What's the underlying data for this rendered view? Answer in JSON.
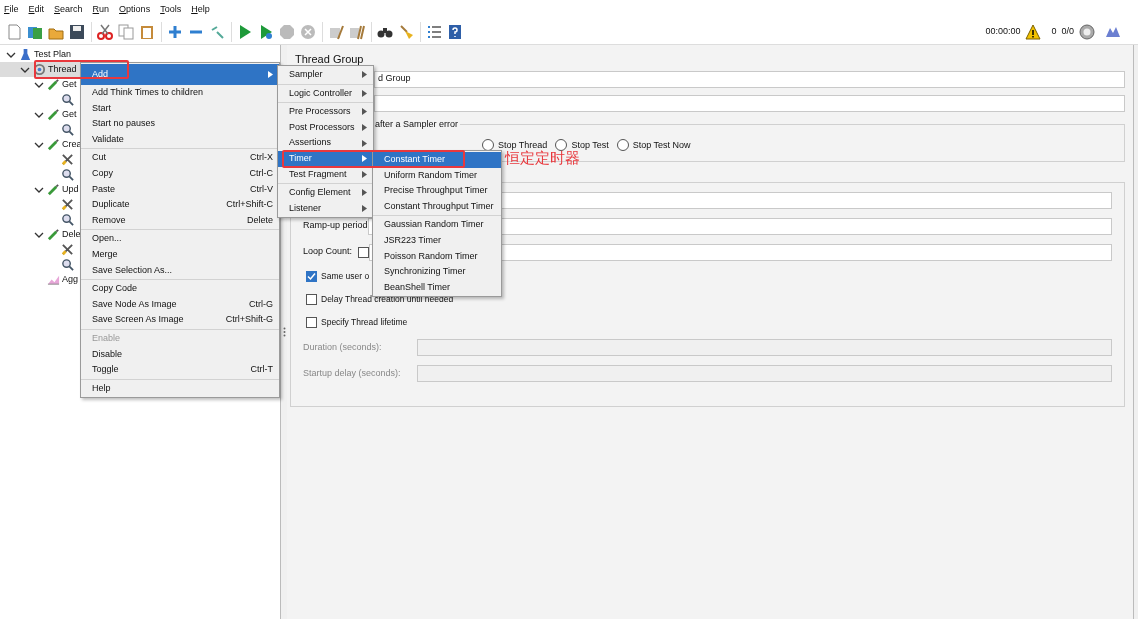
{
  "menubar": [
    {
      "label": "File"
    },
    {
      "label": "Edit"
    },
    {
      "label": "Search"
    },
    {
      "label": "Run"
    },
    {
      "label": "Options"
    },
    {
      "label": "Tools"
    },
    {
      "label": "Help"
    }
  ],
  "status": {
    "elapsed": "00:00:00",
    "warnings": "0",
    "threads": "0/0"
  },
  "tree": [
    {
      "kind": "plan",
      "label": "Test Plan",
      "expanded": true,
      "selected": false,
      "children": [
        {
          "kind": "threadgroup",
          "label": "Thread",
          "expanded": true,
          "selected": true,
          "children": [
            {
              "kind": "sampler",
              "label": "Get",
              "expanded": true,
              "selected": false,
              "children": [
                {
                  "kind": "inspector",
                  "selected": false
                }
              ]
            },
            {
              "kind": "sampler",
              "label": "Get",
              "expanded": true,
              "selected": false,
              "children": [
                {
                  "kind": "inspector",
                  "selected": false
                }
              ]
            },
            {
              "kind": "sampler",
              "label": "Crea",
              "expanded": true,
              "selected": false,
              "children": [
                {
                  "kind": "tool",
                  "selected": false
                },
                {
                  "kind": "inspector",
                  "selected": false
                }
              ]
            },
            {
              "kind": "sampler",
              "label": "Upd",
              "expanded": true,
              "selected": false,
              "children": [
                {
                  "kind": "tool",
                  "selected": false
                },
                {
                  "kind": "inspector",
                  "selected": false
                }
              ]
            },
            {
              "kind": "sampler",
              "label": "Dele",
              "expanded": true,
              "selected": false,
              "children": [
                {
                  "kind": "tool",
                  "selected": false
                },
                {
                  "kind": "inspector",
                  "selected": false
                }
              ]
            },
            {
              "kind": "listener",
              "label": "Agg",
              "selected": false
            }
          ]
        }
      ]
    }
  ],
  "context_menu": {
    "groups": [
      [
        {
          "label": "Add",
          "submenu": true,
          "selected": true,
          "disabled": false,
          "outlined": true
        },
        {
          "label": "Add Think Times to children",
          "selected": false,
          "disabled": false
        },
        {
          "label": "Start",
          "selected": false,
          "disabled": false
        },
        {
          "label": "Start no pauses",
          "selected": false,
          "disabled": false
        },
        {
          "label": "Validate",
          "selected": false,
          "disabled": false
        }
      ],
      [
        {
          "label": "Cut",
          "shortcut": "Ctrl-X",
          "selected": false,
          "disabled": false
        },
        {
          "label": "Copy",
          "shortcut": "Ctrl-C",
          "selected": false,
          "disabled": false
        },
        {
          "label": "Paste",
          "shortcut": "Ctrl-V",
          "selected": false,
          "disabled": false
        },
        {
          "label": "Duplicate",
          "shortcut": "Ctrl+Shift-C",
          "selected": false,
          "disabled": false
        },
        {
          "label": "Remove",
          "shortcut": "Delete",
          "selected": false,
          "disabled": false
        }
      ],
      [
        {
          "label": "Open...",
          "selected": false,
          "disabled": false
        },
        {
          "label": "Merge",
          "selected": false,
          "disabled": false
        },
        {
          "label": "Save Selection As...",
          "selected": false,
          "disabled": false
        }
      ],
      [
        {
          "label": "Copy Code",
          "selected": false,
          "disabled": false
        },
        {
          "label": "Save Node As Image",
          "shortcut": "Ctrl-G",
          "selected": false,
          "disabled": false
        },
        {
          "label": "Save Screen As Image",
          "shortcut": "Ctrl+Shift-G",
          "selected": false,
          "disabled": false
        }
      ],
      [
        {
          "label": "Enable",
          "selected": false,
          "disabled": true
        },
        {
          "label": "Disable",
          "selected": false,
          "disabled": false
        },
        {
          "label": "Toggle",
          "shortcut": "Ctrl-T",
          "selected": false,
          "disabled": false
        }
      ],
      [
        {
          "label": "Help",
          "selected": false,
          "disabled": false
        }
      ]
    ]
  },
  "add_menu": {
    "groups": [
      [
        {
          "label": "Sampler",
          "submenu": true,
          "selected": false
        }
      ],
      [
        {
          "label": "Logic Controller",
          "submenu": true,
          "selected": false
        }
      ],
      [
        {
          "label": "Pre Processors",
          "submenu": true,
          "selected": false
        },
        {
          "label": "Post Processors",
          "submenu": true,
          "selected": false
        },
        {
          "label": "Assertions",
          "submenu": true,
          "selected": false
        },
        {
          "label": "Timer",
          "submenu": true,
          "selected": true,
          "outlined": true
        },
        {
          "label": "Test Fragment",
          "submenu": true,
          "selected": false
        }
      ],
      [
        {
          "label": "Config Element",
          "submenu": true,
          "selected": false
        },
        {
          "label": "Listener",
          "submenu": true,
          "selected": false
        }
      ]
    ]
  },
  "timer_menu": {
    "groups": [
      [
        {
          "label": "Constant Timer",
          "selected": true
        },
        {
          "label": "Uniform Random Timer",
          "selected": false
        },
        {
          "label": "Precise Throughput Timer",
          "selected": false
        },
        {
          "label": "Constant Throughput Timer",
          "selected": false
        }
      ],
      [
        {
          "label": "Gaussian Random Timer",
          "selected": false
        },
        {
          "label": "JSR223 Timer",
          "selected": false
        },
        {
          "label": "Poisson Random Timer",
          "selected": false
        },
        {
          "label": "Synchronizing Timer",
          "selected": false
        },
        {
          "label": "BeanShell Timer",
          "selected": false
        }
      ]
    ]
  },
  "annotation": {
    "text": "恒定定时器"
  },
  "panel": {
    "title": "Thread Group",
    "name_value": "d Group",
    "error_action": {
      "legend": "after a Sampler error",
      "options": [
        {
          "label": "Stop Thread",
          "selected": false
        },
        {
          "label": "Stop Test",
          "selected": false
        },
        {
          "label": "Stop Test Now",
          "selected": false
        }
      ]
    },
    "rampup_label": "Ramp-up period",
    "loop_label": "Loop Count:",
    "infinite": {
      "checked": false
    },
    "checkboxes": [
      {
        "label": "Same user o",
        "checked": true
      },
      {
        "label": "Delay Thread creation until needed",
        "checked": false
      },
      {
        "label": "Specify Thread lifetime",
        "checked": false
      }
    ],
    "lifetime_fields": [
      {
        "label": "Duration (seconds):",
        "disabled": true
      },
      {
        "label": "Startup delay (seconds):",
        "disabled": true
      }
    ]
  }
}
